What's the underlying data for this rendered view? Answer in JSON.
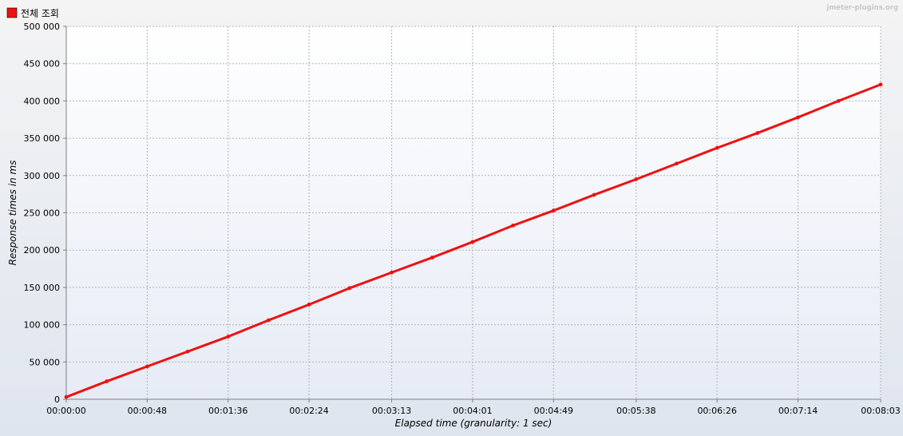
{
  "watermark": "jmeter-plugins.org",
  "chart_data": {
    "type": "line",
    "title": "",
    "xlabel": "Elapsed time (granularity: 1 sec)",
    "ylabel": "Response times in ms",
    "x_unit": "seconds",
    "xlim": [
      0,
      483
    ],
    "ylim": [
      0,
      500000
    ],
    "x_ticks": [
      0,
      48,
      96,
      144,
      193,
      241,
      289,
      338,
      386,
      434,
      483
    ],
    "x_tick_labels": [
      "00:00:00",
      "00:00:48",
      "00:01:36",
      "00:02:24",
      "00:03:13",
      "00:04:01",
      "00:04:49",
      "00:05:38",
      "00:06:26",
      "00:07:14",
      "00:08:03"
    ],
    "y_ticks": [
      0,
      50000,
      100000,
      150000,
      200000,
      250000,
      300000,
      350000,
      400000,
      450000,
      500000
    ],
    "y_tick_labels": [
      "0",
      "50 000",
      "100 000",
      "150 000",
      "200 000",
      "250 000",
      "300 000",
      "350 000",
      "400 000",
      "450 000",
      "500 000"
    ],
    "grid": true,
    "legend_position": "top-left",
    "series": [
      {
        "name": "전체 조회",
        "color": "#ee1111",
        "x": [
          0,
          24,
          48,
          72,
          96,
          120,
          144,
          168,
          193,
          217,
          241,
          265,
          289,
          313,
          338,
          362,
          386,
          410,
          434,
          458,
          483
        ],
        "y": [
          3000,
          24000,
          44000,
          64000,
          84000,
          106000,
          127000,
          149000,
          170000,
          190000,
          211000,
          233000,
          253000,
          274000,
          295000,
          316000,
          337000,
          357000,
          378000,
          400000,
          422000
        ]
      }
    ]
  }
}
